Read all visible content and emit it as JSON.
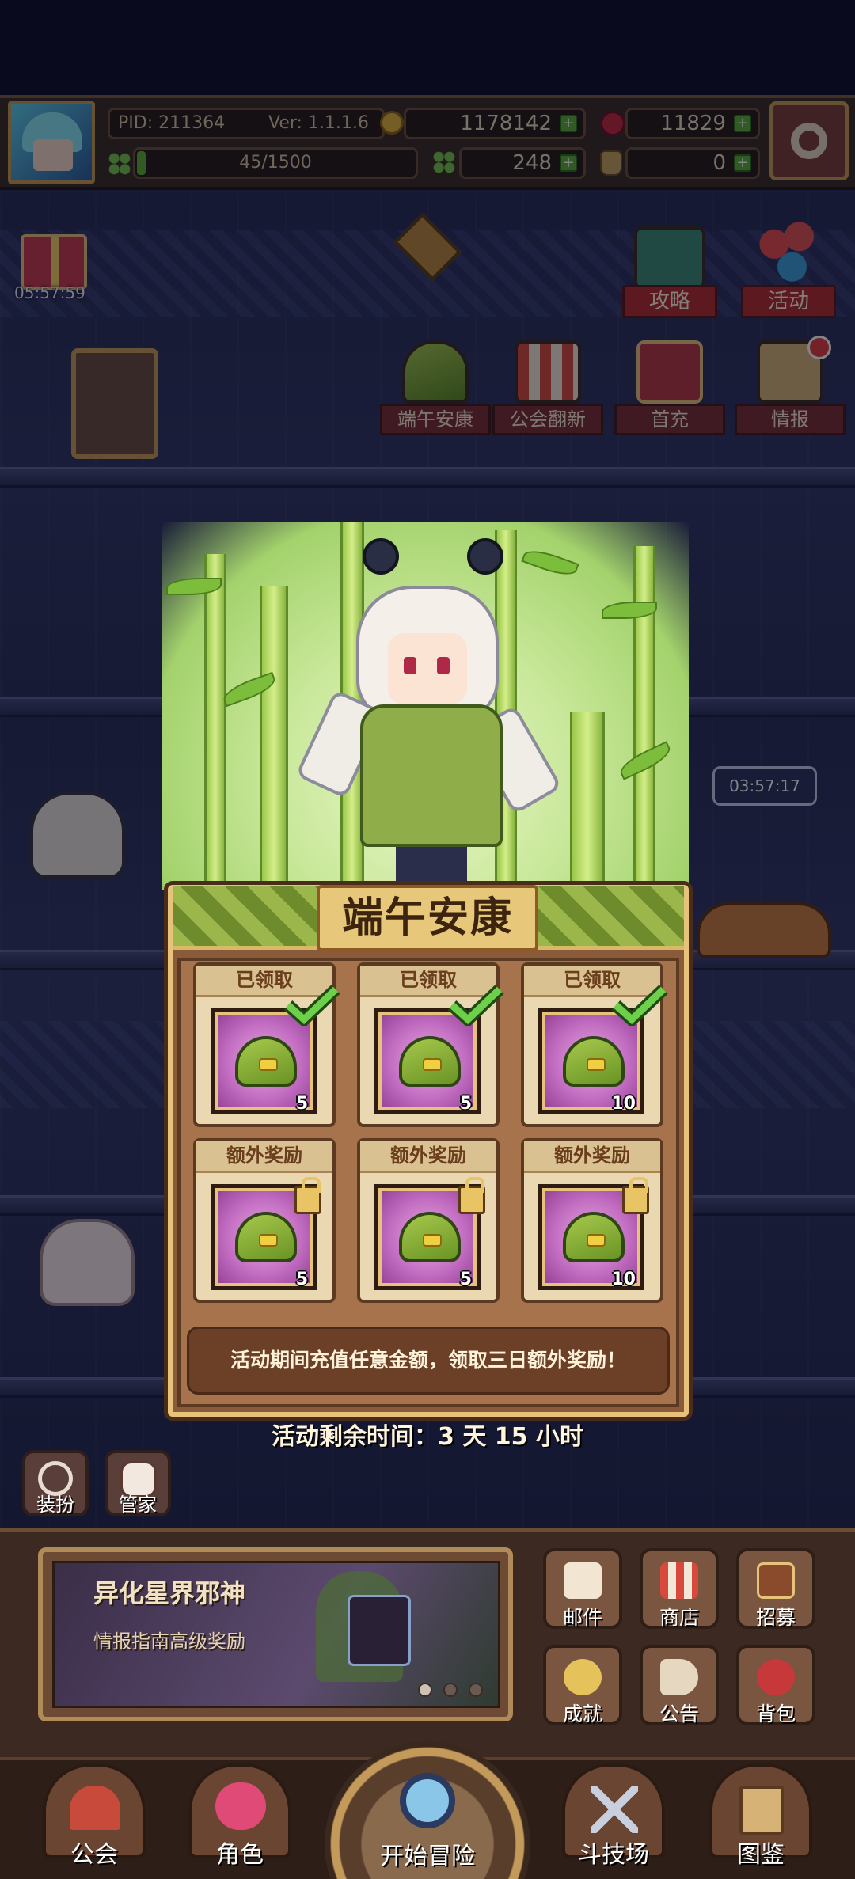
{
  "status_bar": {
    "pid": "PID: 211364",
    "version": "Ver: 1.1.1.6",
    "gold": "1178142",
    "ruby": "11829",
    "exp": "45/1500",
    "clover": "248",
    "bottle": "0",
    "exp_fill_fraction": 0.03
  },
  "timers": {
    "gift_timer": "05:57:59",
    "bubble_timer": "03:57:17"
  },
  "activity_buttons": {
    "row1": [
      "攻略",
      "活动"
    ],
    "row2": [
      "端午安康",
      "公会翻新",
      "首充",
      "情报"
    ]
  },
  "event": {
    "title": "端午安康",
    "claimed_label": "已领取",
    "extra_label": "额外奖励",
    "rewards": [
      {
        "qty": "5"
      },
      {
        "qty": "5"
      },
      {
        "qty": "10"
      }
    ],
    "extra_rewards": [
      {
        "qty": "5"
      },
      {
        "qty": "5"
      },
      {
        "qty": "10"
      }
    ],
    "notice": "活动期间充值任意金额，领取三日额外奖励！",
    "remaining": "活动剩余时间：3 天 15 小时"
  },
  "side_buttons": {
    "dress": "装扮",
    "butler": "管家"
  },
  "promo": {
    "title": "异化星界邪神",
    "subtitle": "情报指南高级奖励"
  },
  "grid_buttons": [
    "邮件",
    "商店",
    "招募",
    "成就",
    "公告",
    "背包"
  ],
  "nav": {
    "guild": "公会",
    "character": "角色",
    "adventure": "开始冒险",
    "arena": "斗技场",
    "codex": "图鉴"
  },
  "colors": {
    "accent_gold": "#e6c27a",
    "banner_red": "#b22a2a",
    "panel_brown": "#8a5b3a",
    "reward_purple": "#c16cc0",
    "check_green": "#5ab034"
  }
}
